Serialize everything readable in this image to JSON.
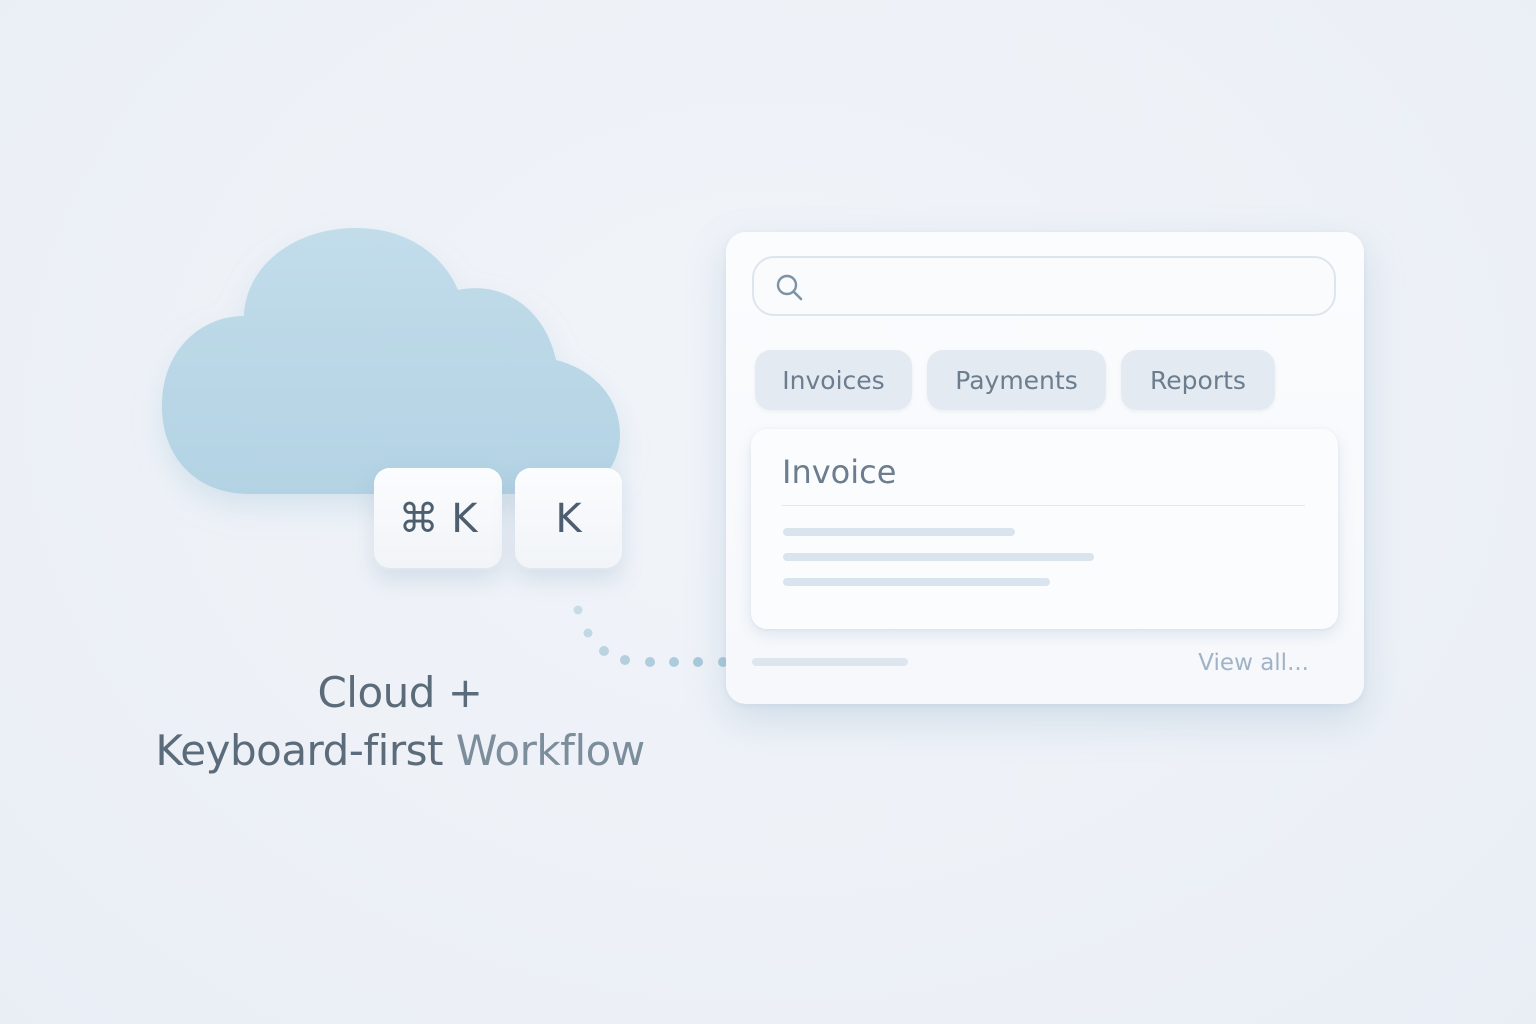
{
  "shortcut": {
    "key_combo_label": "⌘ K",
    "key_single_label": "K"
  },
  "caption": {
    "line1": "Cloud +",
    "line2_prefix": "Keyboard-first",
    "line2_suffix": " Workflow"
  },
  "palette": {
    "search": {
      "value": "",
      "placeholder": ""
    },
    "chips": [
      {
        "label": "Invoices"
      },
      {
        "label": "Payments"
      },
      {
        "label": "Reports"
      }
    ],
    "result": {
      "title": "Invoice"
    },
    "view_all_label": "View all..."
  },
  "colors": {
    "background": "#edf1f7",
    "cloud": "#b9d7e6",
    "accent": "#9fb3c6",
    "text": "#5b6b7a"
  },
  "icons": {
    "cloud": "cloud-icon",
    "search": "search-icon"
  }
}
